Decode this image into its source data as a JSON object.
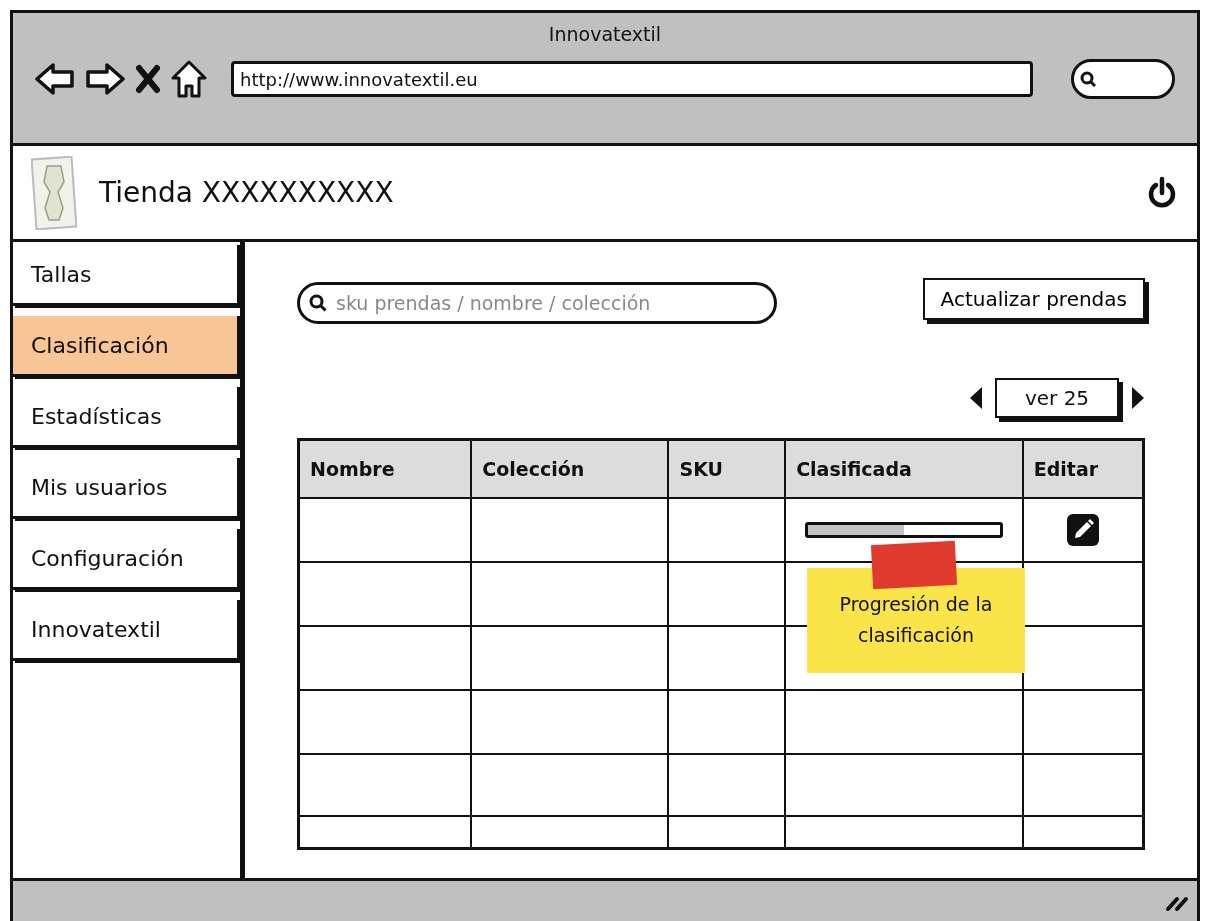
{
  "browser": {
    "title": "Innovatextil",
    "url": "http://www.innovatextil.eu"
  },
  "header": {
    "store_name": "Tienda XXXXXXXXXX"
  },
  "sidebar": {
    "items": [
      {
        "label": "Tallas",
        "selected": false
      },
      {
        "label": "Clasificación",
        "selected": true
      },
      {
        "label": "Estadísticas",
        "selected": false
      },
      {
        "label": "Mis usuarios",
        "selected": false
      },
      {
        "label": "Configuración",
        "selected": false
      },
      {
        "label": "Innovatextil",
        "selected": false
      }
    ]
  },
  "search": {
    "placeholder": "sku prendas / nombre / colección"
  },
  "update_button": "Actualizar prendas",
  "pager": {
    "label": "ver 25"
  },
  "table": {
    "columns": [
      "Nombre",
      "Colección",
      "SKU",
      "Clasificada",
      "Editar"
    ],
    "rows": [
      {
        "kind": "progress",
        "level": 0.5
      },
      {
        "kind": "empty"
      },
      {
        "kind": "empty"
      },
      {
        "kind": "empty"
      },
      {
        "kind": "empty"
      },
      {
        "kind": "empty"
      }
    ]
  },
  "note": {
    "text": "Progresión de la clasificación"
  }
}
